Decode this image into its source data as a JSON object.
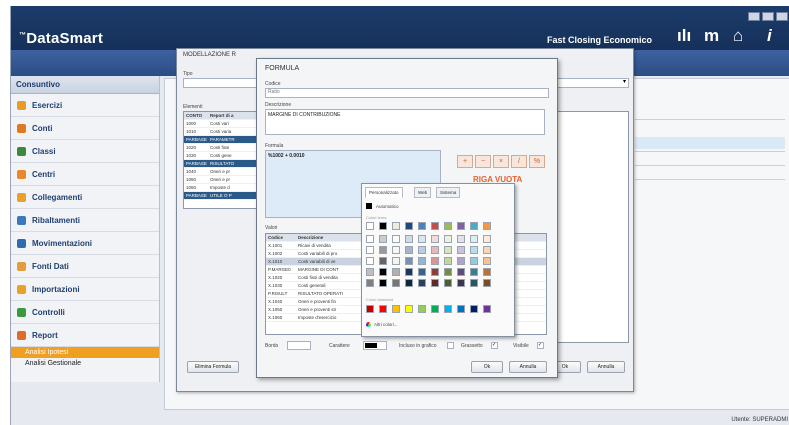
{
  "app": {
    "brand": "DataSmart",
    "brand_mark": "™",
    "tagline": "Fast Closing Economico",
    "header_icons": [
      "bar-chart-icon",
      "m-icon",
      "home-icon",
      "info-icon"
    ]
  },
  "sidebar": {
    "title": "Consuntivo",
    "items": [
      {
        "label": "Esercizi",
        "icon": "calendar-icon",
        "color": "#e89a2c"
      },
      {
        "label": "Conti",
        "icon": "sigma-icon",
        "color": "#e07a22"
      },
      {
        "label": "Classi",
        "icon": "pencil-icon",
        "color": "#3b8a3b"
      },
      {
        "label": "Centri",
        "icon": "target-icon",
        "color": "#e8882a"
      },
      {
        "label": "Collegamenti",
        "icon": "link-icon",
        "color": "#e8a030"
      },
      {
        "label": "Ribaltamenti",
        "icon": "refresh-icon",
        "color": "#3a78c0"
      },
      {
        "label": "Movimentazioni",
        "icon": "grid-icon",
        "color": "#2f6ab3"
      },
      {
        "label": "Fonti Dati",
        "icon": "database-icon",
        "color": "#e0a040"
      },
      {
        "label": "Importazioni",
        "icon": "import-icon",
        "color": "#e8a22a"
      },
      {
        "label": "Controlli",
        "icon": "check-icon",
        "color": "#3c9a3c"
      },
      {
        "label": "Report",
        "icon": "report-icon",
        "color": "#e06a2a"
      }
    ],
    "subitems": [
      {
        "label": "Analisi Ipotesi",
        "active": true
      },
      {
        "label": "Analisi Gestionale",
        "active": false
      }
    ]
  },
  "dialog_main": {
    "title": "MODELLAZIONE R",
    "label_tipo": "Tipo",
    "label_elementi": "Elementi",
    "rows": [
      {
        "code": "CONTO",
        "desc": "Report di a",
        "header": true
      },
      {
        "code": "1000",
        "desc": "Costi vari",
        "sel": false
      },
      {
        "code": "1010",
        "desc": "Costi varia",
        "sel": false
      },
      {
        "code": "PARBASE",
        "desc": "PARAMETR",
        "sel": true
      },
      {
        "code": "1020",
        "desc": "Costi fissi",
        "sel": false
      },
      {
        "code": "1030",
        "desc": "Costi gene",
        "sel": false
      },
      {
        "code": "PARBASE",
        "desc": "RISULTATO",
        "sel": true
      },
      {
        "code": "1040",
        "desc": "Oneri e pr",
        "sel": false
      },
      {
        "code": "1050",
        "desc": "Oneri e pr",
        "sel": false
      },
      {
        "code": "1060",
        "desc": "Imposte d",
        "sel": false
      },
      {
        "code": "PARBASE",
        "desc": "UTILE O P",
        "sel": true
      }
    ],
    "button_formula": "Elimina Formula",
    "button_ok": "Ok",
    "button_cancel": "Annulla"
  },
  "dialog_formula": {
    "title": "FORMULA",
    "label_codice": "Codice",
    "codice_value": "Ratio",
    "label_descrizione": "Descrizione",
    "descrizione_value": "MARGINE DI CONTRIBUZIONE",
    "label_formula": "Formula",
    "formula_value": "%1002 + 0.0010",
    "riga_vuota": "RIGA VUOTA",
    "label_valori": "Valori",
    "values_header": [
      "Codice",
      "Descrizione"
    ],
    "values_rows": [
      {
        "code": "X.1001",
        "desc": "Ricavi di vendita"
      },
      {
        "code": "X.1002",
        "desc": "Costi variabili di pro"
      },
      {
        "code": "X.1010",
        "desc": "Costi variabili di ve"
      },
      {
        "code": "P.MARGE0",
        "desc": "MARGINE DI CONT"
      },
      {
        "code": "X.1020",
        "desc": "Costi fissi di vendita"
      },
      {
        "code": "X.1030",
        "desc": "Costi generali"
      },
      {
        "code": "P.RISULT",
        "desc": "RISULTATO OPERATI"
      },
      {
        "code": "X.1040",
        "desc": "Oneri e proventi fin"
      },
      {
        "code": "X.1050",
        "desc": "Oneri e proventi str"
      },
      {
        "code": "X.1060",
        "desc": "Imposte d'esercizio"
      }
    ],
    "label_bordo": "Bordo",
    "label_carattere": "Carattere",
    "label_grafico": "Incluso in grafico",
    "label_grassetto": "Grassetto",
    "label_visibile": "Visibile",
    "button_ok": "Ok",
    "button_cancel": "Annulla"
  },
  "color_picker": {
    "tabs": [
      "Personalizzato",
      "Web",
      "Sistema"
    ],
    "automatic_label": "Automatico",
    "theme_label": "Colori tema",
    "standard_label": "Colori standard",
    "more_label": "Altri colori...",
    "theme_colors": [
      "#ffffff",
      "#000000",
      "#eeece1",
      "#1f497d",
      "#4f81bd",
      "#c0504d",
      "#9bbb59",
      "#8064a2",
      "#4bacc6",
      "#f79646"
    ],
    "standard_colors": [
      "#c00000",
      "#ff0000",
      "#ffc000",
      "#ffff00",
      "#92d050",
      "#00b050",
      "#00b0f0",
      "#0070c0",
      "#002060",
      "#7030a0"
    ]
  },
  "status": {
    "user": "Utente: SUPERADMI"
  }
}
